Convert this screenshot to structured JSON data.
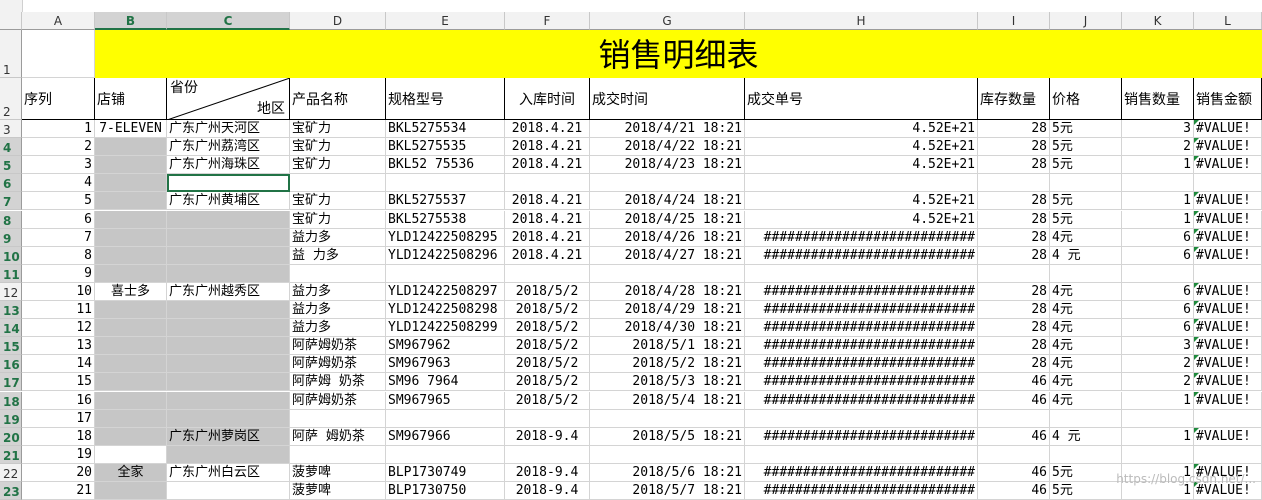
{
  "sheet": {
    "title": "销售明细表",
    "columns": [
      "A",
      "B",
      "C",
      "D",
      "E",
      "F",
      "G",
      "H",
      "I",
      "J",
      "K",
      "L"
    ],
    "selected_columns": [
      "B",
      "C"
    ],
    "headers": {
      "seq": "序列",
      "store": "店铺",
      "province": "省份",
      "region": "地区",
      "product": "产品名称",
      "model": "规格型号",
      "stock_time": "入库时间",
      "deal_time": "成交时间",
      "order_no": "成交单号",
      "stock_qty": "库存数量",
      "price": "价格",
      "sales_qty": "销售数量",
      "sales_amount": "销售金额"
    },
    "rows": [
      {
        "row": "3",
        "seq": "1",
        "store": "7-ELEVEN",
        "region": "广东广州天河区",
        "product": "宝矿力",
        "model": "BKL5275534",
        "stock_time": "2018.4.21",
        "deal_time": "2018/4/21 18:21",
        "order": "4.52E+21",
        "stock": "28",
        "price": "5元",
        "qty": "3",
        "amount": "#VALUE!"
      },
      {
        "row": "4",
        "seq": "2",
        "store": "",
        "region": "广东广州荔湾区",
        "product": "宝矿力",
        "model": "BKL5275535",
        "stock_time": "2018.4.21",
        "deal_time": "2018/4/22 18:21",
        "order": "4.52E+21",
        "stock": "28",
        "price": "5元",
        "qty": "2",
        "amount": "#VALUE!"
      },
      {
        "row": "5",
        "seq": "3",
        "store": "",
        "region": "广东广州海珠区",
        "product": "宝矿力",
        "model": "BKL52 75536",
        "stock_time": "2018.4.21",
        "deal_time": "2018/4/23 18:21",
        "order": "4.52E+21",
        "stock": "28",
        "price": "5元",
        "qty": "1",
        "amount": "#VALUE!"
      },
      {
        "row": "6",
        "seq": "4",
        "store": "",
        "region": "",
        "product": "",
        "model": "",
        "stock_time": "",
        "deal_time": "",
        "order": "",
        "stock": "",
        "price": "",
        "qty": "",
        "amount": ""
      },
      {
        "row": "7",
        "seq": "5",
        "store": "",
        "region": " 广东广州黄埔区",
        "product": "宝矿力",
        "model": "BKL5275537",
        "stock_time": "2018.4.21",
        "deal_time": "2018/4/24 18:21",
        "order": "4.52E+21",
        "stock": "28",
        "price": "5元",
        "qty": "1",
        "amount": "#VALUE!"
      },
      {
        "row": "8",
        "seq": "6",
        "store": "",
        "region": "",
        "product": "宝矿力",
        "model": "BKL5275538",
        "stock_time": "2018.4.21",
        "deal_time": "2018/4/25 18:21",
        "order": "4.52E+21",
        "stock": "28",
        "price": "5元",
        "qty": "1",
        "amount": "#VALUE!"
      },
      {
        "row": "9",
        "seq": "7",
        "store": "",
        "region": "",
        "product": "  益力多",
        "model": "YLD12422508295",
        "stock_time": "2018.4.21",
        "deal_time": "2018/4/26 18:21",
        "order": "###########################",
        "stock": "28",
        "price": "4元",
        "qty": "6",
        "amount": "#VALUE!"
      },
      {
        "row": "10",
        "seq": "8",
        "store": "",
        "region": "",
        "product": "益 力多",
        "model": "YLD12422508296",
        "stock_time": "2018.4.21",
        "deal_time": "2018/4/27 18:21",
        "order": "###########################",
        "stock": "28",
        "price": "4 元",
        "qty": "6",
        "amount": "#VALUE!"
      },
      {
        "row": "11",
        "seq": "9",
        "store": "",
        "region": "",
        "product": "",
        "model": "",
        "stock_time": "",
        "deal_time": "",
        "order": "",
        "stock": "",
        "price": "",
        "qty": "",
        "amount": ""
      },
      {
        "row": "12",
        "seq": "10",
        "store": "喜士多",
        "region": " 广东广州越秀区",
        "product": "益力多",
        "model": "YLD12422508297",
        "stock_time": "2018/5/2",
        "deal_time": "2018/4/28 18:21",
        "order": "###########################",
        "stock": "28",
        "price": "4元",
        "qty": "6",
        "amount": "#VALUE!"
      },
      {
        "row": "13",
        "seq": "11",
        "store": "",
        "region": "",
        "product": "益力多",
        "model": "YLD12422508298",
        "stock_time": "2018/5/2",
        "deal_time": "2018/4/29 18:21",
        "order": "###########################",
        "stock": "28",
        "price": "4元",
        "qty": "6",
        "amount": "#VALUE!"
      },
      {
        "row": "14",
        "seq": "12",
        "store": "",
        "region": "",
        "product": "益力多",
        "model": "YLD12422508299",
        "stock_time": "2018/5/2",
        "deal_time": "2018/4/30 18:21",
        "order": "###########################",
        "stock": "28",
        "price": "4元",
        "qty": "6",
        "amount": "#VALUE!"
      },
      {
        "row": "15",
        "seq": "13",
        "store": "",
        "region": "",
        "product": "阿萨姆奶茶",
        "model": "SM967962",
        "stock_time": "2018/5/2",
        "deal_time": "2018/5/1 18:21",
        "order": "###########################",
        "stock": "28",
        "price": "4元",
        "qty": "3",
        "amount": "#VALUE!"
      },
      {
        "row": "16",
        "seq": "14",
        "store": "",
        "region": "",
        "product": "阿萨姆奶茶",
        "model": "SM967963",
        "stock_time": "2018/5/2",
        "deal_time": "2018/5/2 18:21",
        "order": "###########################",
        "stock": "28",
        "price": "4元",
        "qty": "2",
        "amount": "#VALUE!"
      },
      {
        "row": "17",
        "seq": "15",
        "store": "",
        "region": "",
        "product": "阿萨姆 奶茶",
        "model": "SM96 7964",
        "stock_time": "2018/5/2",
        "deal_time": "2018/5/3 18:21",
        "order": "###########################",
        "stock": "46",
        "price": "4元",
        "qty": "2",
        "amount": "#VALUE!"
      },
      {
        "row": "18",
        "seq": "16",
        "store": "",
        "region": "",
        "product": "阿萨姆奶茶",
        "model": "SM967965",
        "stock_time": "2018/5/2",
        "deal_time": "2018/5/4 18:21",
        "order": "###########################",
        "stock": "46",
        "price": "4元",
        "qty": "1",
        "amount": "#VALUE!"
      },
      {
        "row": "19",
        "seq": "17",
        "store": "",
        "region": "",
        "product": "",
        "model": "",
        "stock_time": "",
        "deal_time": "",
        "order": "",
        "stock": "",
        "price": "",
        "qty": "",
        "amount": ""
      },
      {
        "row": "20",
        "seq": "18",
        "store": "",
        "region": " 广东广州萝岗区",
        "product": "阿萨 姆奶茶",
        "model": "SM967966",
        "stock_time": "2018-9.4",
        "deal_time": "2018/5/5 18:21",
        "order": "###########################",
        "stock": "46",
        "price": "4 元",
        "qty": "1",
        "amount": "#VALUE!"
      },
      {
        "row": "21",
        "seq": "19",
        "store": "",
        "region": "",
        "product": "",
        "model": "",
        "stock_time": "",
        "deal_time": "",
        "order": "",
        "stock": "",
        "price": "",
        "qty": "",
        "amount": ""
      },
      {
        "row": "22",
        "seq": "20",
        "store": "全家",
        "region": " 广东广州白云区",
        "product": "菠萝啤",
        "model": "BLP1730749",
        "stock_time": "2018-9.4",
        "deal_time": "2018/5/6 18:21",
        "order": "###########################",
        "stock": "46",
        "price": "5元",
        "qty": "1",
        "amount": "#VALUE!"
      },
      {
        "row": "23",
        "seq": "21",
        "store": "",
        "region": "",
        "product": "菠萝啤",
        "model": "BLP1730750",
        "stock_time": "2018-9.4",
        "deal_time": "2018/5/7 18:21",
        "order": "###########################",
        "stock": "46",
        "price": "5元",
        "qty": "1",
        "amount": "#VALUE!"
      }
    ],
    "watermark": "https://blog.csdn.net/..."
  }
}
